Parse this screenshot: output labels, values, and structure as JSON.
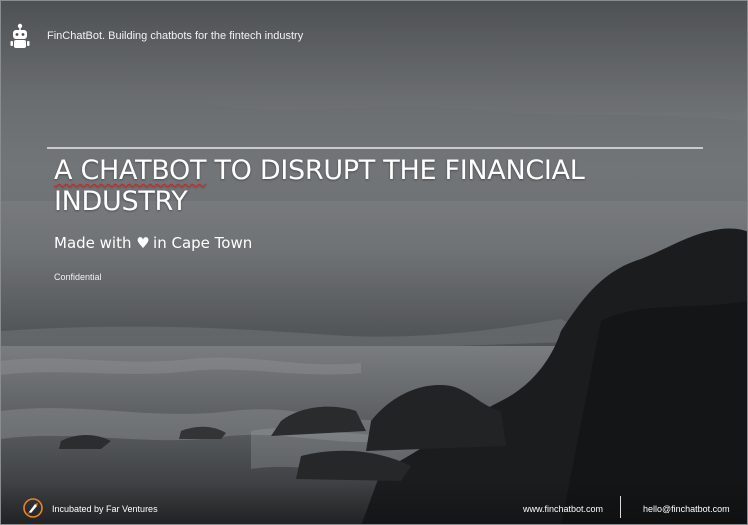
{
  "header": {
    "text": "FinChatBot. Building chatbots for the fintech industry",
    "logo_icon": "robot-icon"
  },
  "title": {
    "word1": "A CHATBOT",
    "rest_line1": " TO DISRUPT THE FINANCIAL",
    "line2": "INDUSTRY"
  },
  "subtitle": {
    "prefix": "Made with",
    "heart": "♥",
    "suffix": "in Cape Town"
  },
  "confidential": "Confidential",
  "footer": {
    "incubated": "Incubated by Far Ventures",
    "incubator_icon": "rocket-icon",
    "website": "www.finchatbot.com",
    "email": "hello@finchatbot.com"
  },
  "colors": {
    "text": "#ffffff",
    "rule": "#c8cacc",
    "spellcheck": "#d62020",
    "logo_orange": "#e8832a"
  }
}
